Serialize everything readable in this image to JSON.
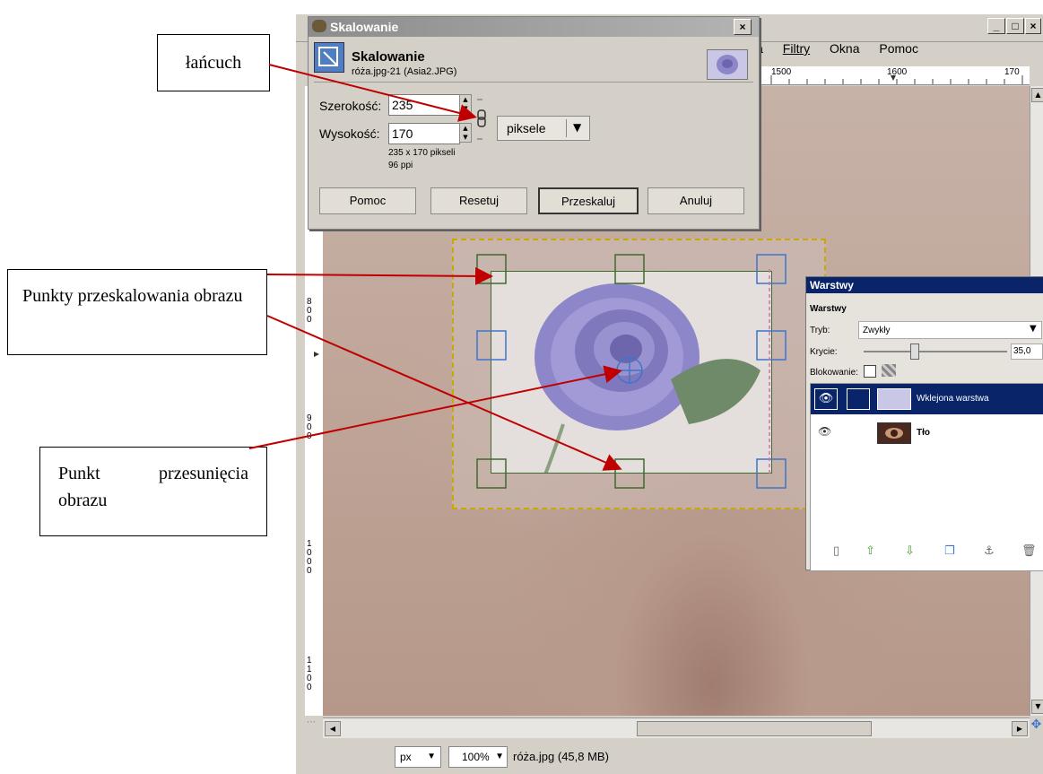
{
  "annotations": {
    "chain": "łańcuch",
    "scale_points": "Punkty przeskalowania obrazu",
    "move_point_line1": "Punkt przesunięcia",
    "move_point_line2": "obrazu"
  },
  "gimp": {
    "menu": [
      "ia",
      "Filtry",
      "Okna",
      "Pomoc"
    ],
    "ruler_labels": [
      "1500",
      "1600",
      "170"
    ],
    "vruler_labels": [
      "800",
      "900",
      "1000",
      "1100"
    ]
  },
  "dialog": {
    "title": "Skalowanie",
    "heading": "Skalowanie",
    "subheading": "róża.jpg-21 (Asia2.JPG)",
    "width_label": "Szerokość:",
    "width_value": "235",
    "height_label": "Wysokość:",
    "height_value": "170",
    "unit": "piksele",
    "size_info": "235 x 170 pikseli",
    "ppi_info": "96 ppi",
    "buttons": {
      "help": "Pomoc",
      "reset": "Resetuj",
      "scale": "Przeskaluj",
      "cancel": "Anuluj"
    },
    "close": "×"
  },
  "layers": {
    "title": "Warstwy",
    "section": "Warstwy",
    "mode_label": "Tryb:",
    "mode_value": "Zwykły",
    "opacity_label": "Krycie:",
    "opacity_value": "35,0",
    "lock_label": "Blokowanie:",
    "items": [
      {
        "name": "Wklejona warstwa"
      },
      {
        "name": "Tło"
      }
    ]
  },
  "statusbar": {
    "unit": "px",
    "zoom": "100%",
    "file_info": "róża.jpg (45,8 MB)"
  },
  "colors": {
    "arrow": "#c00000",
    "selection_title": "#0a246a",
    "handle_green": "#3e6b2e",
    "handle_blue": "#3f74c9"
  }
}
